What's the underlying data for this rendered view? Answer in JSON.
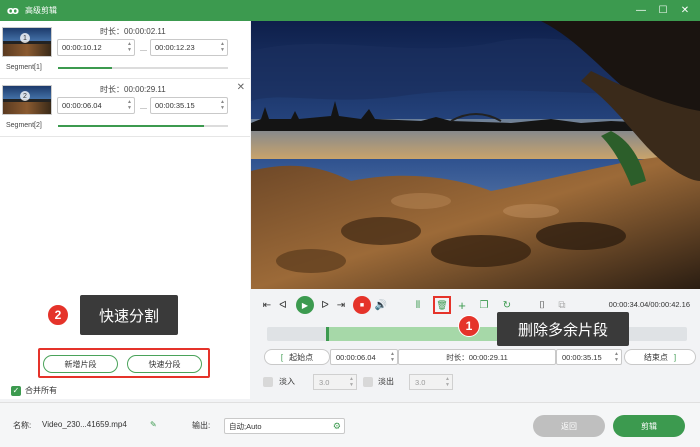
{
  "window": {
    "title": "高级剪辑",
    "controls": [
      "minimize",
      "maximize",
      "close"
    ]
  },
  "segments": [
    {
      "label": "Segment[1]",
      "number": "1",
      "duration": "时长：00:00:02.11",
      "start": "00:00:10.12",
      "end": "00:00:12.23",
      "progress": 0.32
    },
    {
      "label": "Segment[2]",
      "number": "2",
      "duration": "时长：00:00:29.11",
      "start": "00:00:06.04",
      "end": "00:00:35.15",
      "progress": 0.86
    }
  ],
  "left_buttons": {
    "add_segment": "新增片段",
    "quick_split": "快速分段"
  },
  "merge_all": "合并所有",
  "callouts": [
    {
      "number": "1",
      "text": "删除多余片段"
    },
    {
      "number": "2",
      "text": "快速分割"
    }
  ],
  "player": {
    "time": "00:00:34.04/00:00:42.16",
    "selection_start_fraction": 0.14,
    "selection_end_fraction": 0.83
  },
  "trim": {
    "start_label": "起始点",
    "start_value": "00:00:06.04",
    "duration": "时长：00:00:29.11",
    "end_value": "00:00:35.15",
    "end_label": "结束点"
  },
  "fade": {
    "fade_in_label": "淡入",
    "fade_in_value": "3.0",
    "fade_out_label": "淡出",
    "fade_out_value": "3.0"
  },
  "footer": {
    "name_label": "名称:",
    "file_name": "Video_230...41659.mp4",
    "output_label": "输出:",
    "output_value": "自动;Auto",
    "back_button": "返回",
    "edit_button": "剪辑"
  },
  "colors": {
    "brand_green": "#3c9a4f",
    "highlight_red": "#e5332a"
  }
}
